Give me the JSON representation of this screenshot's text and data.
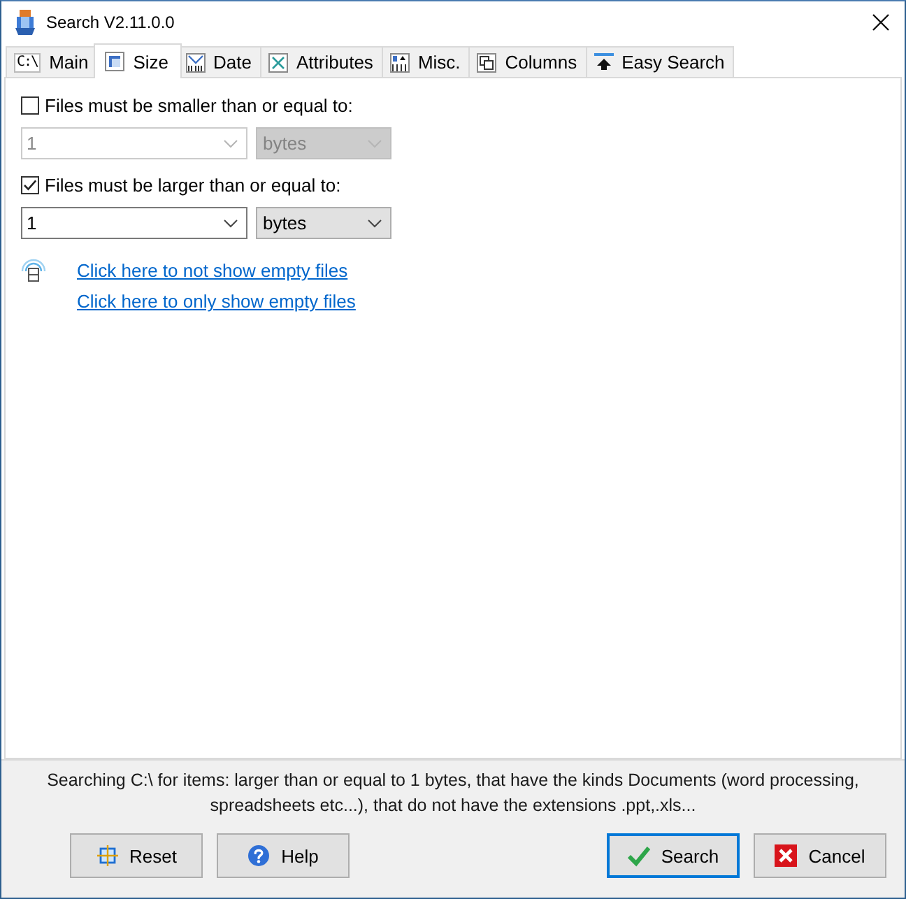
{
  "window": {
    "title": "Search V2.11.0.0"
  },
  "tabs": [
    {
      "label": "Main",
      "icon_text": "C:\\",
      "selected": false
    },
    {
      "label": "Size",
      "selected": true
    },
    {
      "label": "Date",
      "selected": false
    },
    {
      "label": "Attributes",
      "selected": false
    },
    {
      "label": "Misc.",
      "selected": false
    },
    {
      "label": "Columns",
      "selected": false
    },
    {
      "label": "Easy Search",
      "selected": false
    }
  ],
  "size_filters": [
    {
      "label": "Files must be smaller than or equal to:",
      "checked": false,
      "value": "1",
      "unit": "bytes"
    },
    {
      "label": "Files must be larger than or equal to:",
      "checked": true,
      "value": "1",
      "unit": "bytes"
    }
  ],
  "links": [
    "Click here to not show empty files",
    "Click here to only show empty files"
  ],
  "status_text": "Searching C:\\ for items: larger than or equal to 1 bytes, that have the kinds Documents (word processing, spreadsheets etc...), that do not have the extensions .ppt,.xls...",
  "buttons": [
    {
      "kind": "reset",
      "label": "Reset",
      "default": false
    },
    {
      "kind": "help",
      "label": "Help",
      "default": false
    },
    {
      "kind": "search",
      "label": "Search",
      "default": true
    },
    {
      "kind": "cancel",
      "label": "Cancel",
      "default": false
    }
  ]
}
